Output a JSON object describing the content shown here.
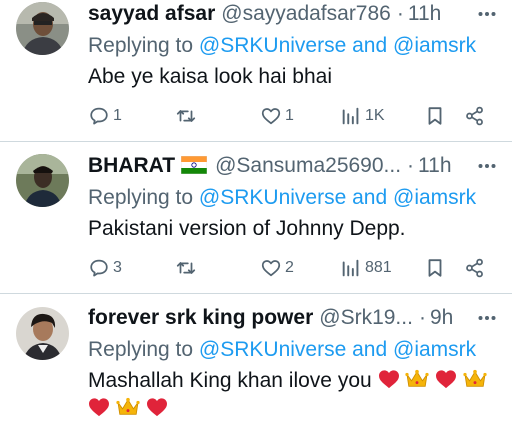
{
  "tweets": [
    {
      "name": "sayyad afsar",
      "handle": "@sayyadafsar786",
      "dot": "·",
      "time": "11h",
      "replying_prefix": "Replying to",
      "mention1": "@SRKUniverse",
      "and_word": "and",
      "mention2": "@iamsrk",
      "text": "Abe ye kaisa look hai bhai",
      "replies": "1",
      "retweets": "",
      "likes": "1",
      "views": "1K",
      "flag": ""
    },
    {
      "name": "BHARAT",
      "handle": "@Sansuma25690...",
      "dot": "·",
      "time": "11h",
      "replying_prefix": "Replying to",
      "mention1": "@SRKUniverse",
      "and_word": "and",
      "mention2": "@iamsrk",
      "text": "Pakistani version of Johnny Depp.",
      "replies": "3",
      "retweets": "",
      "likes": "2",
      "views": "881",
      "flag": "india-flag"
    },
    {
      "name": "forever srk king power",
      "handle": "@Srk19...",
      "dot": "·",
      "time": "9h",
      "replying_prefix": "Replying to",
      "mention1": "@SRKUniverse",
      "and_word": "and",
      "mention2": "@iamsrk",
      "text": "Mashallah King khan ilove you",
      "emojis_line1": [
        "heart",
        "crown",
        "heart",
        "crown"
      ],
      "emojis_line2": [
        "heart",
        "crown",
        "heart"
      ],
      "flag": ""
    }
  ],
  "icons": {
    "reply": "comment-icon",
    "retweet": "retweet-icon",
    "like": "heart-icon",
    "views": "views-icon",
    "bookmark": "bookmark-icon",
    "share": "share-icon",
    "more": "more-icon"
  },
  "colors": {
    "link": "#1d9bf0",
    "muted": "#536471",
    "text": "#0f1419",
    "divider": "#cfd9de",
    "emoji_heart": "#e0243a",
    "emoji_crown": "#f5b40a"
  }
}
